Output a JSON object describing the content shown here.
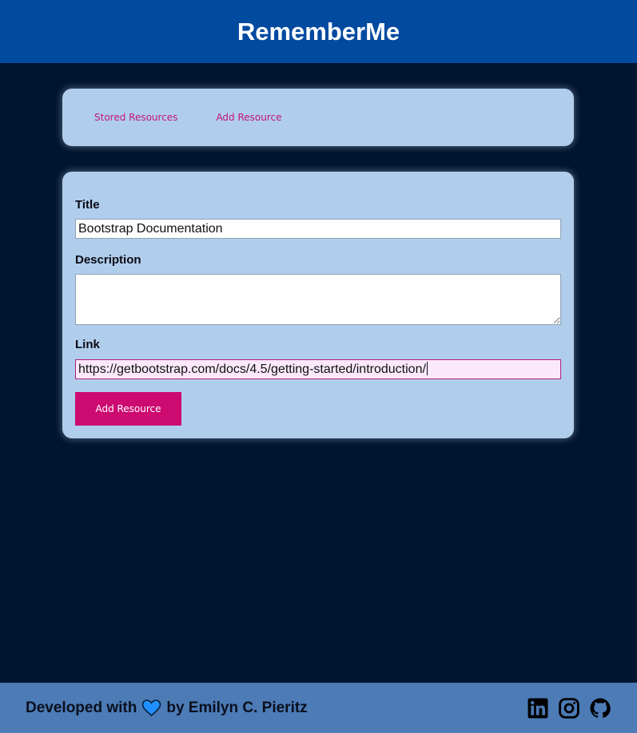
{
  "app": {
    "title": "RememberMe"
  },
  "nav": {
    "items": [
      {
        "label": "Stored Resources"
      },
      {
        "label": "Add Resource"
      }
    ]
  },
  "form": {
    "title_label": "Title",
    "title_value": "Bootstrap Documentation",
    "description_label": "Description",
    "description_value": "",
    "link_label": "Link",
    "link_value": "https://getbootstrap.com/docs/4.5/getting-started/introduction/",
    "submit_label": "Add Resource"
  },
  "footer": {
    "developed_with": "Developed with",
    "by_author": "by Emilyn C. Pieritz",
    "heart_icon": "heart-icon",
    "social": [
      "linkedin-icon",
      "instagram-icon",
      "github-icon"
    ]
  },
  "colors": {
    "header": "#004aa0",
    "background": "#00152f",
    "card": "#b0cdec",
    "accent": "#cc0a70",
    "footer": "#4c7bb5"
  }
}
